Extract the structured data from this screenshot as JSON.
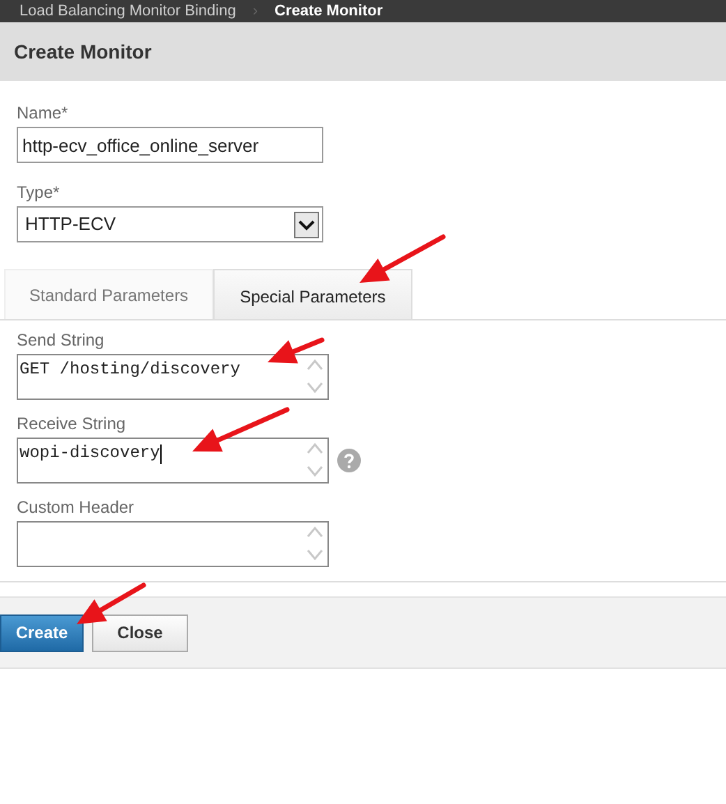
{
  "breadcrumb": [
    {
      "label": "Load Balancing Monitor Binding",
      "current": false
    },
    {
      "label": "Create Monitor",
      "current": true
    }
  ],
  "breadcrumb_separator": "›",
  "title": "Create Monitor",
  "name_field": {
    "label": "Name*",
    "value": "http-ecv_office_online_server"
  },
  "type_field": {
    "label": "Type*",
    "value": "HTTP-ECV"
  },
  "tabs": [
    {
      "label": "Standard Parameters",
      "selected": false
    },
    {
      "label": "Special Parameters",
      "selected": true
    }
  ],
  "text_areas": [
    {
      "label": "Send String",
      "value": "GET /hosting/discovery",
      "help": false,
      "caret": false
    },
    {
      "label": "Receive String",
      "value": "wopi-discovery",
      "help": true,
      "caret": true
    },
    {
      "label": "Custom Header",
      "help": false,
      "caret": false
    }
  ],
  "buttons": [
    {
      "label": "Create",
      "kind": "primary"
    },
    {
      "label": "Close",
      "kind": "secondary"
    }
  ]
}
